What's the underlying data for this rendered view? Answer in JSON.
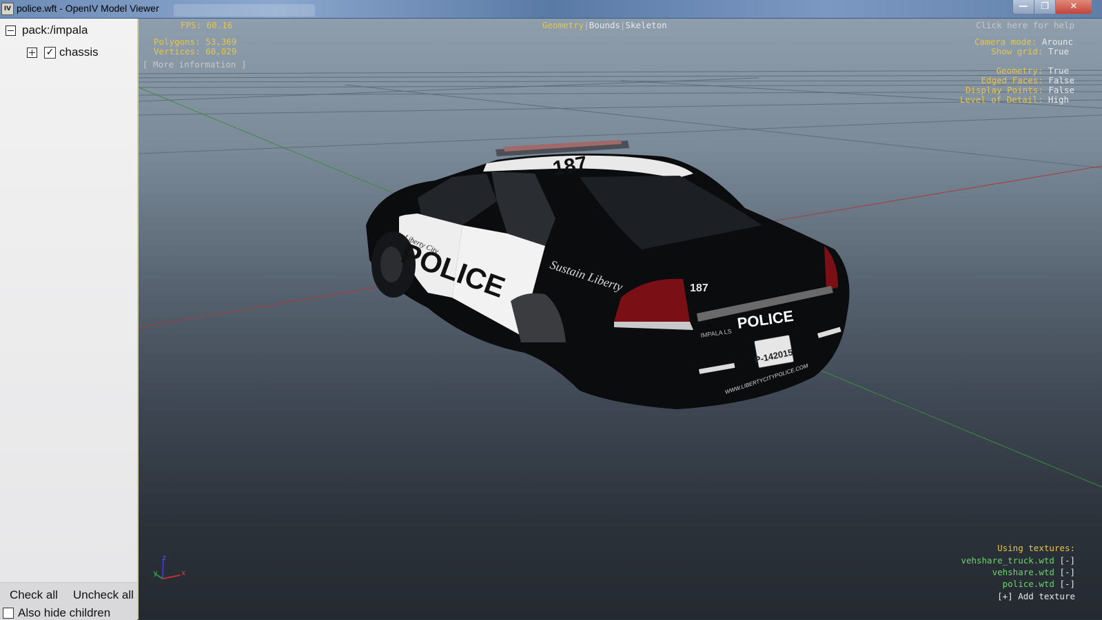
{
  "window": {
    "icon_text": "IV",
    "title": "police.wft - OpenIV Model Viewer",
    "minimize_glyph": "—",
    "maximize_glyph": "❐",
    "close_glyph": "✕"
  },
  "tree": {
    "root_label": "pack:/impala",
    "child_label": "chassis",
    "child_checked": true
  },
  "left_bottom": {
    "check_all": "Check all",
    "uncheck_all": "Uncheck all",
    "also_hide_children": "Also hide children"
  },
  "stats": {
    "fps": "FPS: 60.16",
    "polygons": "Polygons: 53,369",
    "vertices": "Vertices: 60,029",
    "more_info": "[ More information ]"
  },
  "view_modes": {
    "geometry": "Geometry",
    "sep1": "|",
    "bounds": "Bounds",
    "sep2": "|",
    "skeleton": "Skeleton"
  },
  "help": "Click here for help",
  "settings": {
    "camera_mode_label": "Camera mode:",
    "camera_mode_value": "Arounc",
    "show_grid_label": "Show grid:",
    "show_grid_value": "True",
    "geometry_label": "Geometry:",
    "geometry_value": "True",
    "edged_faces_label": "Edged Faces:",
    "edged_faces_value": "False",
    "display_points_label": "Display Points:",
    "display_points_value": "False",
    "lod_label": "Level of Detail:",
    "lod_value": "High"
  },
  "textures": {
    "heading": "Using textures:",
    "items": [
      {
        "name": "vehshare_truck.wtd",
        "action": "[-]"
      },
      {
        "name": "vehshare.wtd",
        "action": "[-]"
      },
      {
        "name": "police.wtd",
        "action": "[-]"
      }
    ],
    "add": "[+] Add texture"
  },
  "axis": {
    "y": "y",
    "z": "z",
    "x": "x"
  },
  "car": {
    "roof_number": "187",
    "door_city": "Liberty City",
    "door_text": "POLICE",
    "motto": "Sustain Liberty",
    "trunk_number": "187",
    "trunk_text": "POLICE",
    "model": "IMPALA LS",
    "plate": "P-142015",
    "website": "WWW.LIBERTYCITYPOLICE.COM"
  }
}
